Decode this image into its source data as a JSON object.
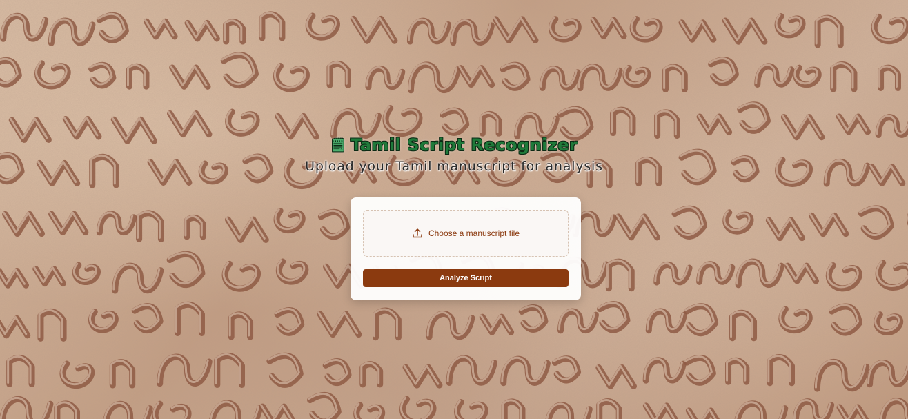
{
  "header": {
    "icon": "scroll-icon",
    "title": "Tamil Script Recognizer",
    "subtitle": "Upload your Tamil manuscript for analysis"
  },
  "upload": {
    "icon": "upload-icon",
    "label": "Choose a manuscript file"
  },
  "actions": {
    "analyze_label": "Analyze Script"
  },
  "colors": {
    "accent": "#8b3a0f",
    "title_green": "#1f7a3a",
    "stone": "#c9a98e"
  }
}
